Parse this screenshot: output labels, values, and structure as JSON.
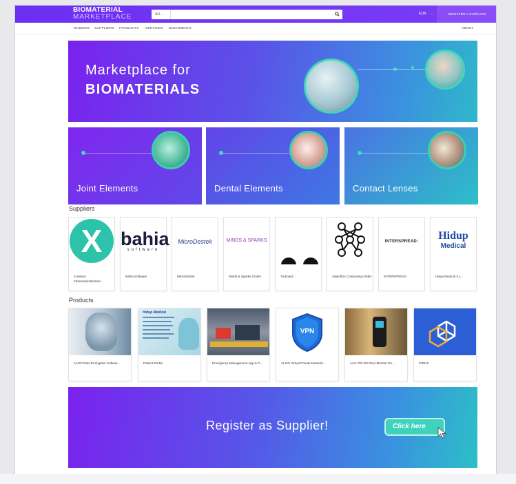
{
  "header": {
    "logo_line1": "BIOMATERIAL",
    "logo_line2": "MARKETPLACE",
    "search_scope": "ALL",
    "search_value": "",
    "currency": "EUR",
    "register_label": "REGISTER A SUPPLIER"
  },
  "nav": {
    "items": [
      "TENDERS",
      "SUPPLIERS",
      "PRODUCTS",
      "SERVICES",
      "DOCUMENTS"
    ],
    "about": "ABOUT"
  },
  "hero": {
    "line1": "Marketplace for",
    "line2": "BIOMATERIALS"
  },
  "categories": [
    "Joint Elements",
    "Dental Elements",
    "Contact Lenses"
  ],
  "suppliers": {
    "title": "Suppliers",
    "items": [
      {
        "name": "x-tention Informationstechno...",
        "logo": "X"
      },
      {
        "name": "Bahia Software",
        "logo": "bahia",
        "logo_sub": "software"
      },
      {
        "name": "MicroDestek",
        "logo": "MicroDestek"
      },
      {
        "name": "Minds & Sparks GmbH",
        "logo": "MINDS & SPARKS"
      },
      {
        "name": "Turboard",
        "logo": ""
      },
      {
        "name": "Algorithm Computing GmbH",
        "logo": ""
      },
      {
        "name": "INTERSPREAD",
        "logo": "INTERSPREAD:"
      },
      {
        "name": "Hidup Medical S.L.",
        "logo": "Hidup",
        "logo_sub": "Medical"
      }
    ]
  },
  "products": {
    "title": "Products",
    "items": [
      {
        "name": "ALGO Data Encryption Softwar..."
      },
      {
        "name": "Patient Portal"
      },
      {
        "name": "Emergency Management App & P..."
      },
      {
        "name": "ALGO Virtual Private Network..."
      },
      {
        "name": "Acro 703 DS Door Monitor De..."
      },
      {
        "name": "CIRUS"
      }
    ],
    "vpn_label": "VPN",
    "portal_brand": "Hidup Medical"
  },
  "banner": {
    "text": "Register as Supplier!",
    "button": "Click here"
  },
  "colors": {
    "brand": "#7437f4",
    "accent": "#3fd3bd"
  }
}
